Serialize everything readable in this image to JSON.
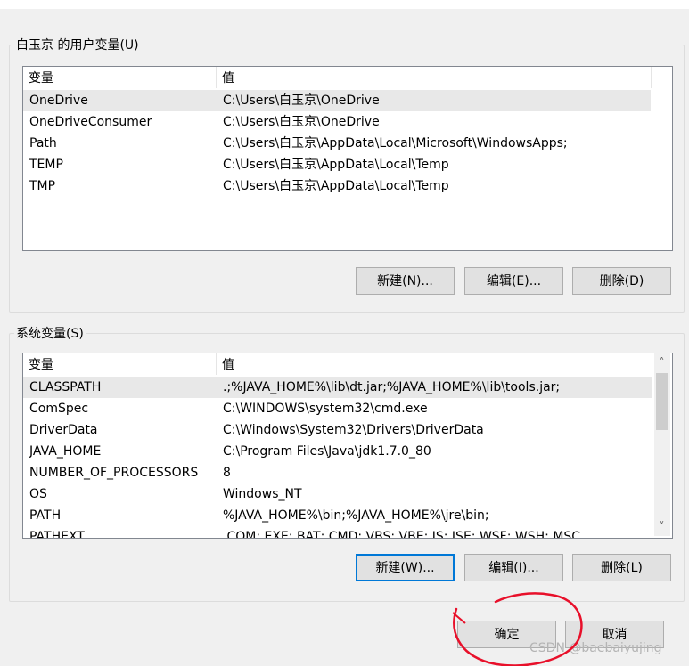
{
  "user_vars": {
    "title": "白玉京 的用户变量(U)",
    "col_variable": "变量",
    "col_value": "值",
    "rows": [
      {
        "name": "OneDrive",
        "value": "C:\\Users\\白玉京\\OneDrive"
      },
      {
        "name": "OneDriveConsumer",
        "value": "C:\\Users\\白玉京\\OneDrive"
      },
      {
        "name": "Path",
        "value": "C:\\Users\\白玉京\\AppData\\Local\\Microsoft\\WindowsApps;"
      },
      {
        "name": "TEMP",
        "value": "C:\\Users\\白玉京\\AppData\\Local\\Temp"
      },
      {
        "name": "TMP",
        "value": "C:\\Users\\白玉京\\AppData\\Local\\Temp"
      }
    ],
    "new_label": "新建(N)...",
    "edit_label": "编辑(E)...",
    "delete_label": "删除(D)"
  },
  "system_vars": {
    "title": "系统变量(S)",
    "col_variable": "变量",
    "col_value": "值",
    "rows": [
      {
        "name": "CLASSPATH",
        "value": ".;%JAVA_HOME%\\lib\\dt.jar;%JAVA_HOME%\\lib\\tools.jar;"
      },
      {
        "name": "ComSpec",
        "value": "C:\\WINDOWS\\system32\\cmd.exe"
      },
      {
        "name": "DriverData",
        "value": "C:\\Windows\\System32\\Drivers\\DriverData"
      },
      {
        "name": "JAVA_HOME",
        "value": "C:\\Program Files\\Java\\jdk1.7.0_80"
      },
      {
        "name": "NUMBER_OF_PROCESSORS",
        "value": "8"
      },
      {
        "name": "OS",
        "value": "Windows_NT"
      },
      {
        "name": "PATH",
        "value": "%JAVA_HOME%\\bin;%JAVA_HOME%\\jre\\bin;"
      },
      {
        "name": "PATHEXT",
        "value": ".COM;.EXE;.BAT;.CMD;.VBS;.VBE;.JS;.JSE;.WSF;.WSH;.MSC"
      }
    ],
    "new_label": "新建(W)...",
    "edit_label": "编辑(I)...",
    "delete_label": "删除(L)"
  },
  "dialog": {
    "ok_label": "确定",
    "cancel_label": "取消"
  },
  "watermark": "CSDN @baebaiyujing",
  "colors": {
    "annotation_circle": "#e8102a",
    "default_button_border": "#0078d7"
  }
}
